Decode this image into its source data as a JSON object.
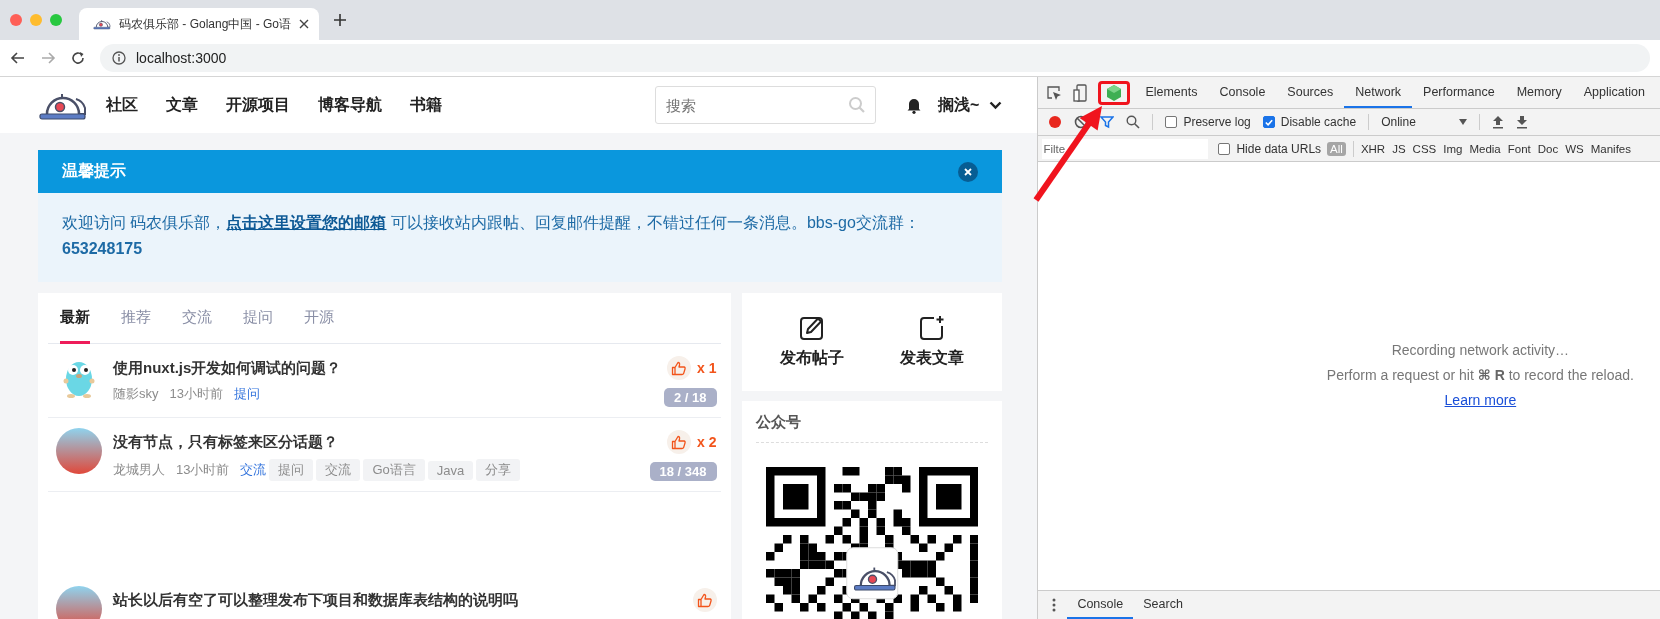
{
  "browser": {
    "tab_title": "码农俱乐部 - Golang中国 - Go语",
    "url": "localhost:3000"
  },
  "site": {
    "nav": [
      "社区",
      "文章",
      "开源项目",
      "博客导航",
      "书籍"
    ],
    "search": {
      "placeholder": "搜索"
    },
    "user": "搁浅~"
  },
  "notice": {
    "title": "温馨提示",
    "before": "欢迎访问 码农俱乐部，",
    "link": "点击这里设置您的邮箱",
    "after": " 可以接收站内跟帖、回复邮件提醒，不错过任何一条消息。bbs-go交流群：**653248175**"
  },
  "tabs": [
    {
      "label": "最新",
      "selected": true
    },
    {
      "label": "推荐",
      "selected": false
    },
    {
      "label": "交流",
      "selected": false
    },
    {
      "label": "提问",
      "selected": false
    },
    {
      "label": "开源",
      "selected": false
    }
  ],
  "posts": [
    {
      "kind": "mascot",
      "title": "使用nuxt.js开发如何调试的问题？",
      "author": "随影sky",
      "time": "13小时前",
      "node": "提问",
      "likes": "x 1",
      "count": "2 / 18"
    },
    {
      "kind": "picture",
      "title": "没有节点，只有标签来区分话题？",
      "author": "龙城男人",
      "time": "13小时前",
      "node": "交流",
      "tags": [
        "提问",
        "交流",
        "Go语言",
        "Java",
        "分享"
      ],
      "likes": "x 2",
      "count": "18 / 348"
    },
    {
      "kind": "picture",
      "title": "站长以后有空了可以整理发布下项目和数据库表结构的说明吗"
    }
  ],
  "sidebar": {
    "actions": [
      {
        "kind": "edit",
        "label": "发布帖子"
      },
      {
        "kind": "add",
        "label": "发表文章"
      }
    ],
    "qr_title": "公众号"
  },
  "devtools": {
    "tabs": [
      {
        "label": "Elements",
        "selected": false
      },
      {
        "label": "Console",
        "selected": false
      },
      {
        "label": "Sources",
        "selected": false
      },
      {
        "label": "Network",
        "selected": true
      },
      {
        "label": "Performance",
        "selected": false
      },
      {
        "label": "Memory",
        "selected": false
      },
      {
        "label": "Application",
        "selected": false
      }
    ],
    "toolbar": {
      "recording": true,
      "preserve_log": {
        "label": "Preserve log",
        "checked": false
      },
      "disable_cache": {
        "label": "Disable cache",
        "checked": true
      },
      "throttling": "Online"
    },
    "filter": {
      "placeholder": "Filte",
      "hide_data_urls": {
        "label": "Hide data URLs",
        "checked": false
      },
      "types": [
        {
          "label": "All",
          "selected": true
        },
        {
          "label": "XHR",
          "selected": false
        },
        {
          "label": "JS",
          "selected": false
        },
        {
          "label": "CSS",
          "selected": false
        },
        {
          "label": "Img",
          "selected": false
        },
        {
          "label": "Media",
          "selected": false
        },
        {
          "label": "Font",
          "selected": false
        },
        {
          "label": "Doc",
          "selected": false
        },
        {
          "label": "WS",
          "selected": false
        },
        {
          "label": "Manifes",
          "selected": false
        }
      ]
    },
    "empty_state": {
      "title": "Recording network activity…",
      "hint": "Perform a request or hit **⌘ R** to record the reload.",
      "link": "Learn more"
    },
    "drawer_tabs": [
      {
        "label": "Console",
        "selected": true
      },
      {
        "label": "Search",
        "selected": false
      }
    ]
  }
}
